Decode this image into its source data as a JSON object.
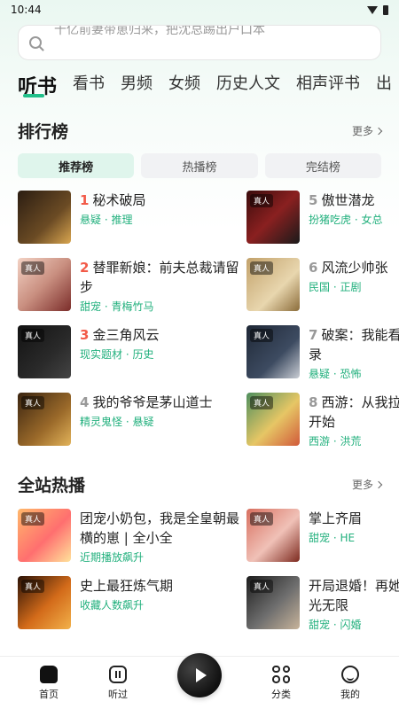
{
  "status": {
    "time": "10:44"
  },
  "search": {
    "placeholder": "十亿前妻带崽归来，把沈总踢出户口本"
  },
  "tabs": [
    "听书",
    "看书",
    "男频",
    "女频",
    "历史人文",
    "相声评书",
    "出"
  ],
  "rank_section": {
    "title": "排行榜",
    "more": "更多",
    "filters": [
      "推荐榜",
      "热播榜",
      "完结榜"
    ],
    "items": [
      {
        "rank": "1",
        "title": "秘术破局",
        "meta": "悬疑 · 推理",
        "badge": ""
      },
      {
        "rank": "5",
        "title": "傲世潜龙",
        "meta": "扮猪吃虎 · 女总",
        "badge": "真人"
      },
      {
        "rank": "2",
        "title": "替罪新娘：前夫总裁请留步",
        "meta": "甜宠 · 青梅竹马",
        "badge": "真人"
      },
      {
        "rank": "6",
        "title": "风流少帅张",
        "meta": "民国 · 正剧",
        "badge": "真人"
      },
      {
        "rank": "3",
        "title": "金三角风云",
        "meta": "现实题材 · 历史",
        "badge": "真人"
      },
      {
        "rank": "7",
        "title": "破案：我能看记录",
        "meta": "悬疑 · 恐怖",
        "badge": "真人"
      },
      {
        "rank": "4",
        "title": "我的爷爷是茅山道士",
        "meta": "精灵鬼怪 · 悬疑",
        "badge": "真人"
      },
      {
        "rank": "8",
        "title": "西游：从我拉空开始",
        "meta": "西游 · 洪荒",
        "badge": "真人"
      }
    ]
  },
  "hot_section": {
    "title": "全站热播",
    "more": "更多",
    "items": [
      {
        "title": "团宠小奶包，我是全皇朝最横的崽 | 全小全",
        "meta": "近期播放飙升",
        "badge": "真人"
      },
      {
        "title": "掌上齐眉",
        "meta": "甜宠 · HE",
        "badge": "真人"
      },
      {
        "title": "史上最狂炼气期",
        "meta": "收藏人数飙升",
        "badge": "真人"
      },
      {
        "title": "开局退婚！再她风光无限",
        "meta": "甜宠 · 闪婚",
        "badge": "真人"
      }
    ]
  },
  "bottom_nav": {
    "home": "首页",
    "heard": "听过",
    "category": "分类",
    "profile": "我的"
  },
  "colors": {
    "accent": "#22c08a",
    "rank_red": "#f25a48"
  }
}
